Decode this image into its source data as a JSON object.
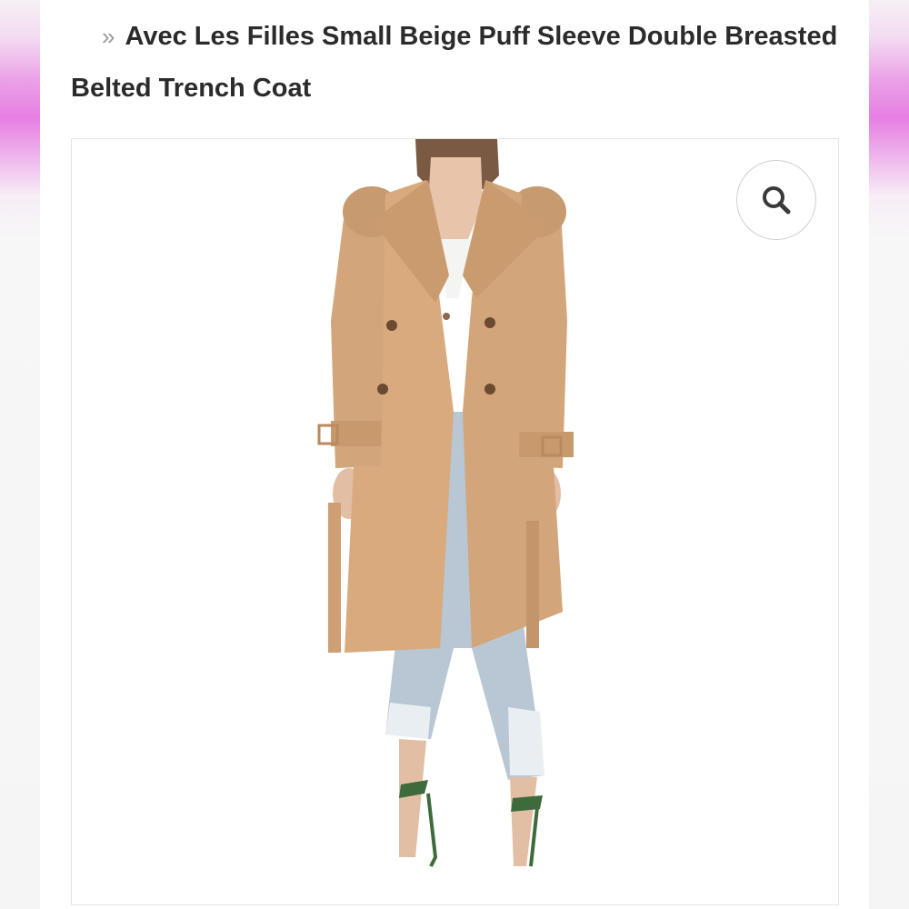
{
  "breadcrumb": {
    "separator": "»",
    "title": "Avec Les Filles Small Beige Puff Sleeve Double Breasted Belted Trench Coat"
  },
  "gallery": {
    "zoom_icon": "search-icon",
    "image_subject": "beige double-breasted belted trench coat worn with light ripped jeans and green strappy heels"
  },
  "colors": {
    "side_accent": "#e67fe3",
    "coat": "#d3a57a",
    "jeans": "#b9c6d3",
    "heels": "#3f6b3c"
  }
}
